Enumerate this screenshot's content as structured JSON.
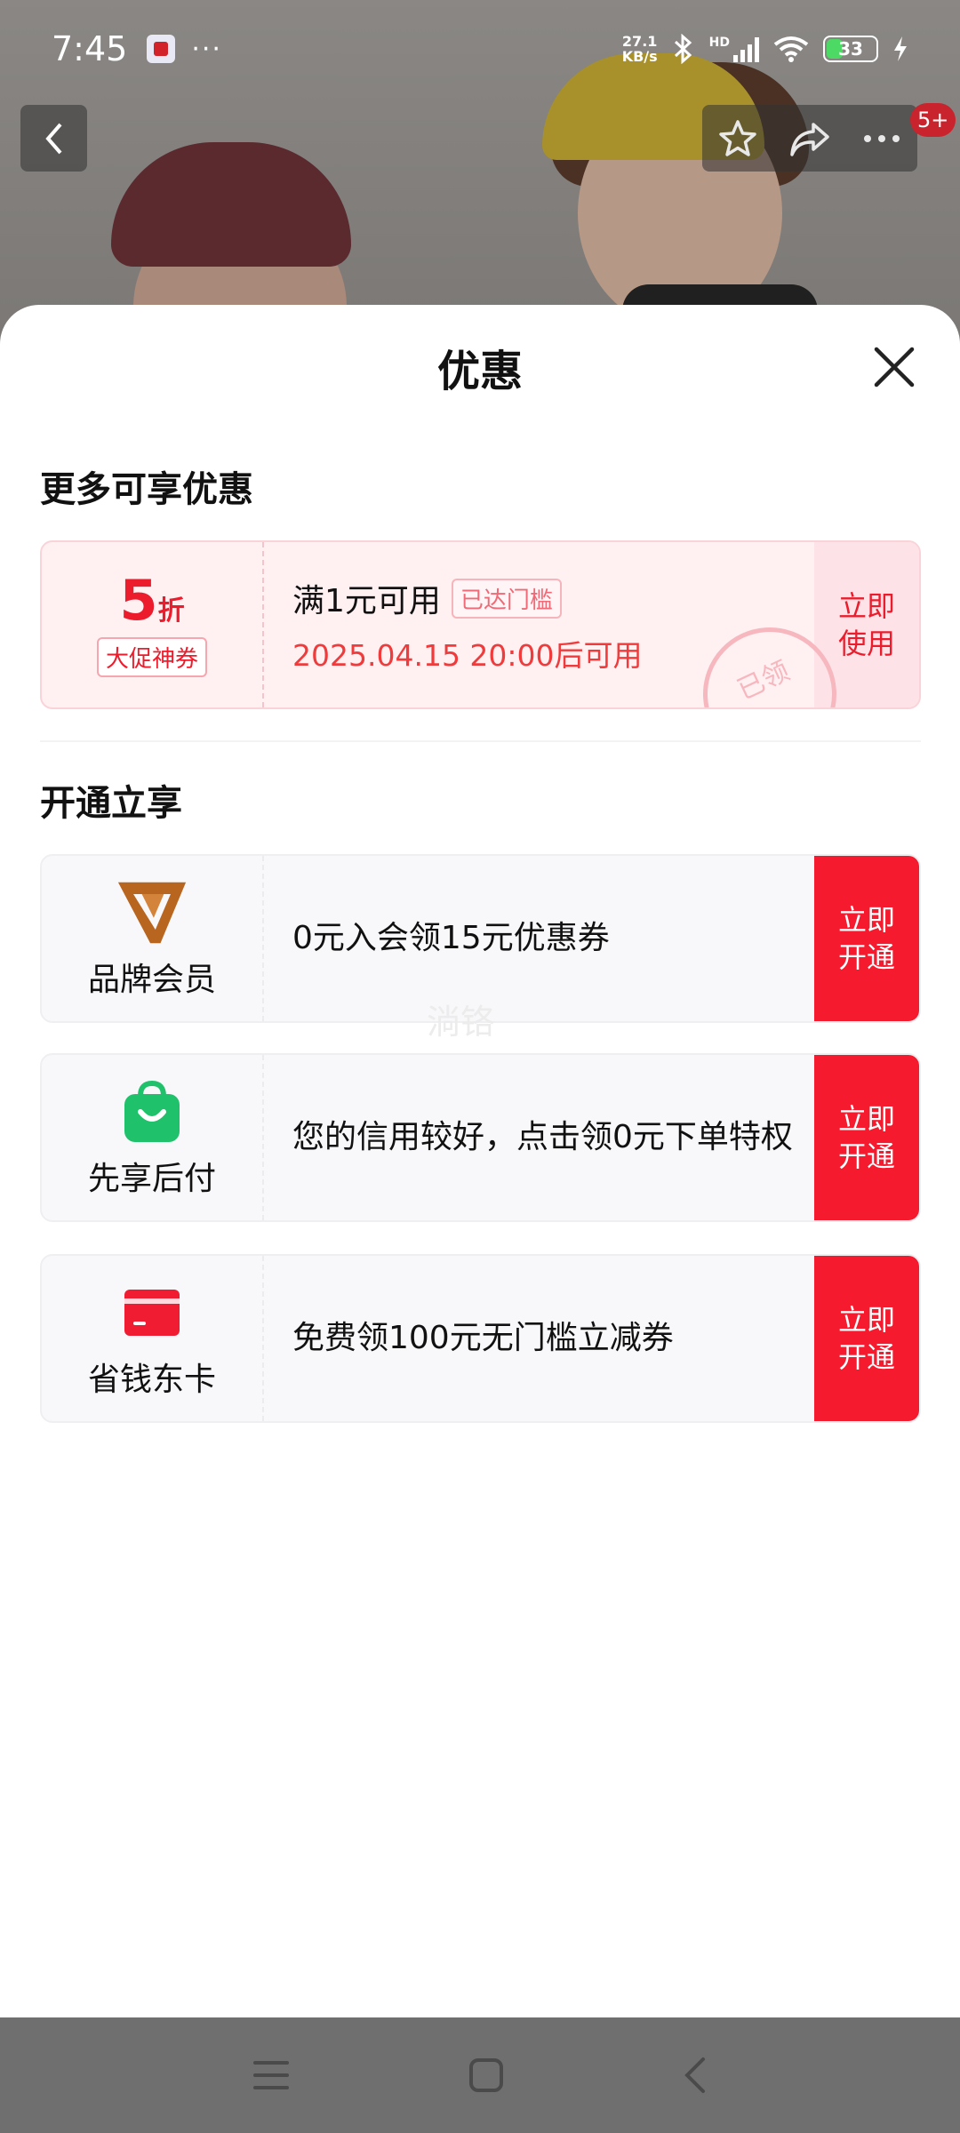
{
  "status_bar": {
    "time": "7:45",
    "dots": "···",
    "net_speed_value": "27.1",
    "net_speed_unit": "KB/s",
    "network_type": "HD",
    "battery": "33"
  },
  "nav": {
    "badge": "5+"
  },
  "sheet": {
    "title": "优惠",
    "section1_title": "更多可享优惠",
    "coupon": {
      "discount_value": "5",
      "discount_unit": "折",
      "tag": "大促神券",
      "condition": "满1元可用",
      "reached_tag": "已达门槛",
      "time": "2025.04.15 20:00后可用",
      "stamp": "已领",
      "action_line1": "立即",
      "action_line2": "使用"
    },
    "section2_title": "开通立享",
    "services": [
      {
        "name": "品牌会员",
        "icon": "brand-v-icon",
        "desc": "0元入会领15元优惠券",
        "action_line1": "立即",
        "action_line2": "开通"
      },
      {
        "name": "先享后付",
        "icon": "shopping-bag-icon",
        "desc": "您的信用较好，点击领0元下单特权",
        "action_line1": "立即",
        "action_line2": "开通"
      },
      {
        "name": "省钱东卡",
        "icon": "card-icon",
        "desc": "免费领100元无门槛立减券",
        "action_line1": "立即",
        "action_line2": "开通"
      }
    ],
    "watermark": "淌铬"
  },
  "colors": {
    "accent_red": "#f51a2e",
    "coupon_bg": "#fff0f2",
    "brand_orange": "#b8651f",
    "bag_green": "#1fc16b"
  }
}
